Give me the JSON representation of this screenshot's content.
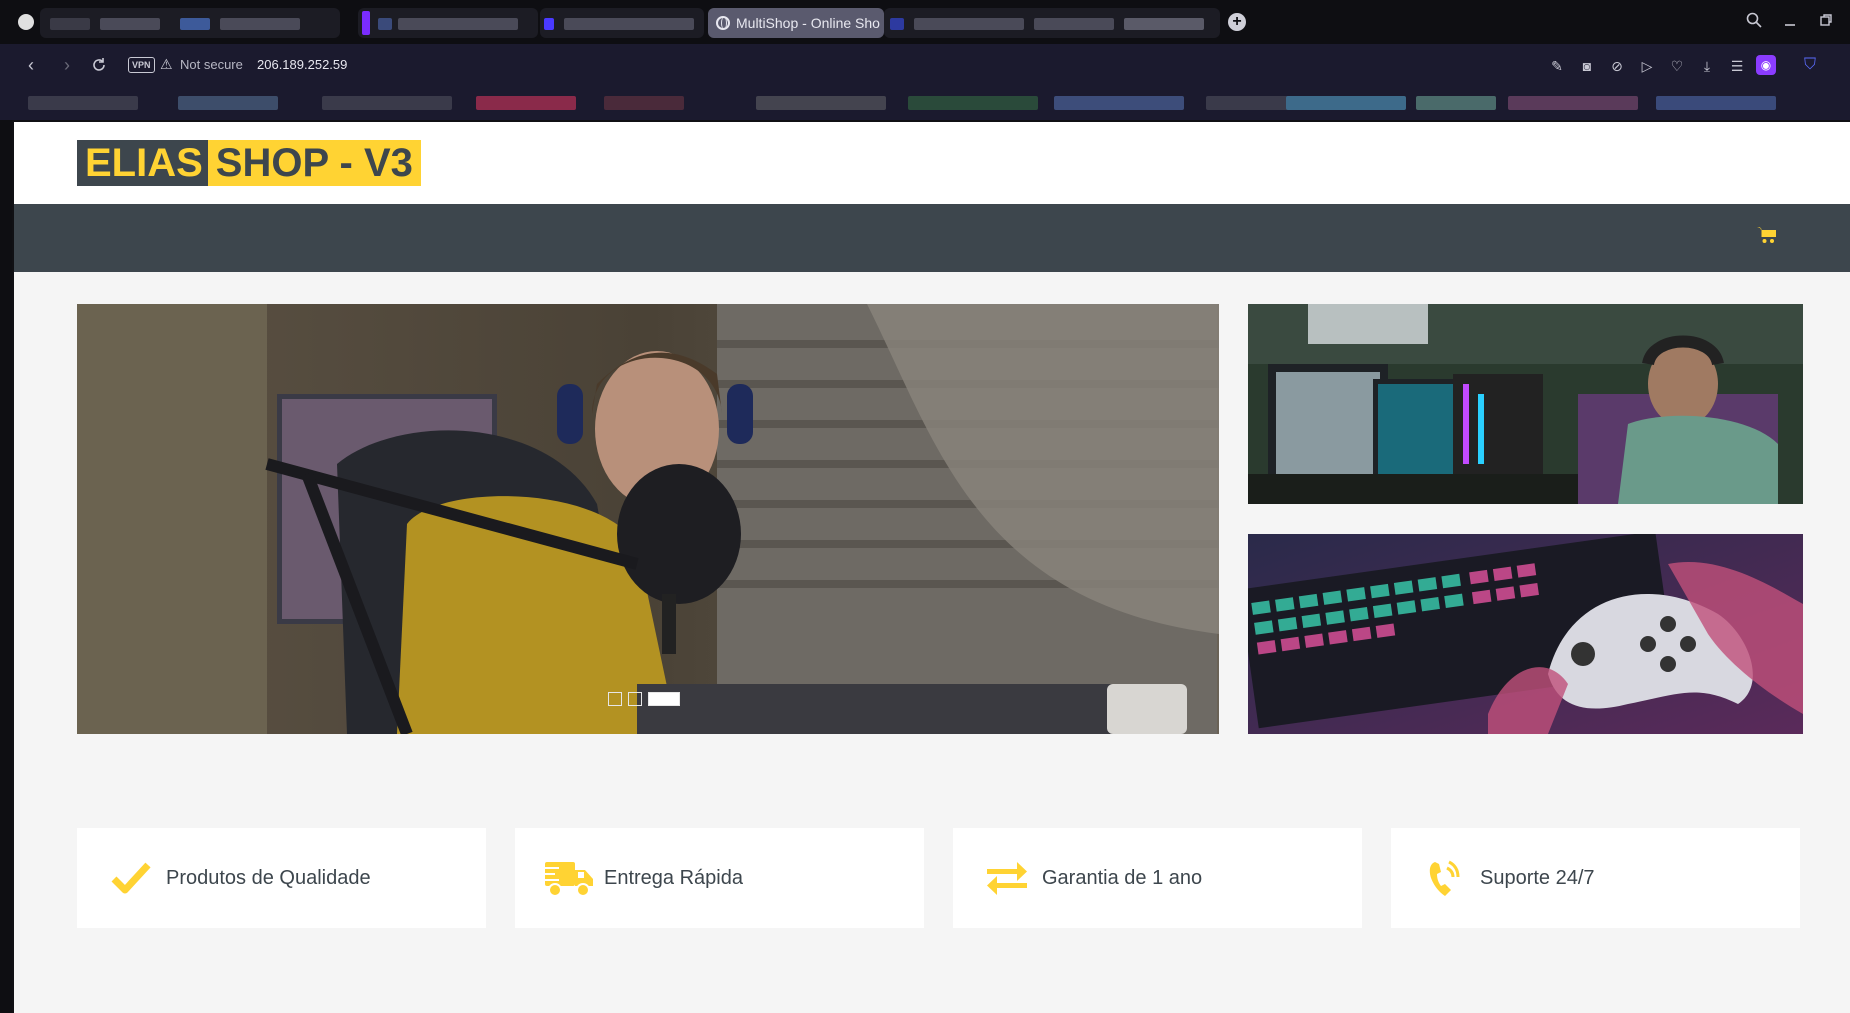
{
  "browser": {
    "active_tab_title": "MultiShop - Online Sho",
    "address": {
      "security_label": "Not secure",
      "url": "206.189.252.59",
      "vpn_label": "VPN"
    },
    "new_tab_label": "+",
    "icons": [
      "search-icon",
      "minimize-icon",
      "restore-icon",
      "edit-icon",
      "camera-icon",
      "block-icon",
      "play-icon",
      "heart-icon",
      "download-icon",
      "menu-icon",
      "profile-icon",
      "bitwarden-icon"
    ]
  },
  "site": {
    "logo": {
      "part1": "ELIAS",
      "part2": "SHOP - V3"
    },
    "colors": {
      "primary": "#ffd333",
      "dark": "#3d464d",
      "background": "#f5f5f5"
    },
    "carousel": {
      "slide_count": 3,
      "active_index": 2
    },
    "features": [
      {
        "icon": "check-icon",
        "label": "Produtos de Qualidade"
      },
      {
        "icon": "truck-icon",
        "label": "Entrega Rápida"
      },
      {
        "icon": "exchange-icon",
        "label": "Garantia de 1 ano"
      },
      {
        "icon": "phone-volume-icon",
        "label": "Suporte 24/7"
      }
    ]
  }
}
